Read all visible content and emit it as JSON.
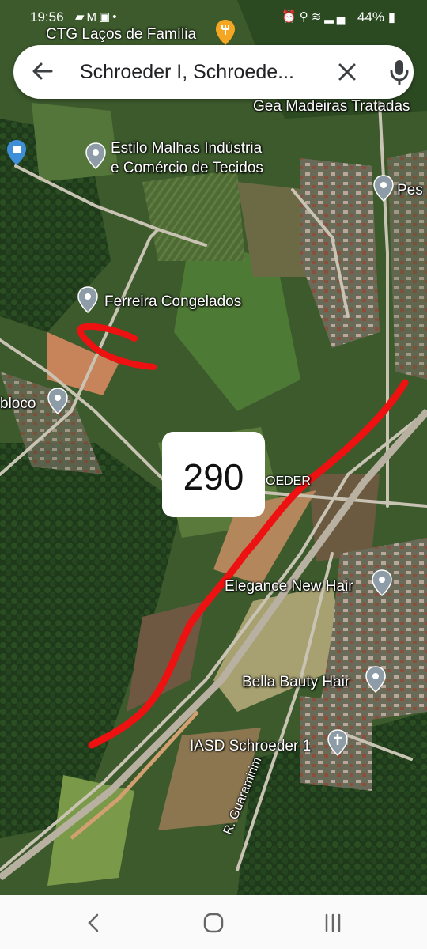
{
  "status_bar": {
    "time": "19:56",
    "notification_icons": [
      "chat-icon",
      "mail-icon",
      "photo-icon",
      "dot-icon"
    ],
    "system_icons": [
      "alarm-icon",
      "location-icon",
      "wifi-icon",
      "signal-icon"
    ],
    "battery": "44%"
  },
  "search": {
    "query": "Schroeder I, Schroede..."
  },
  "map": {
    "top_label": "CTG Laços de Família",
    "places": {
      "gea": "Gea Madeiras Tratadas",
      "estilo_line1": "Estilo Malhas Indústria",
      "estilo_line2": "e Comércio de Tecidos",
      "pes": "Pes",
      "ferreira": "Ferreira Congelados",
      "bloco": "bloco",
      "oeder": "OEDER",
      "elegance": "Elegance New Hair",
      "bella": "Bella Bauty Hair",
      "iasd": "IASD Schroeder 1",
      "street": "R. Guaramirim"
    },
    "badge_text": "290",
    "pin_color": "#8d9ca6",
    "annotation_color": "#ee1111"
  },
  "nav": {
    "icons": [
      "back-icon",
      "home-icon",
      "recents-icon"
    ]
  }
}
